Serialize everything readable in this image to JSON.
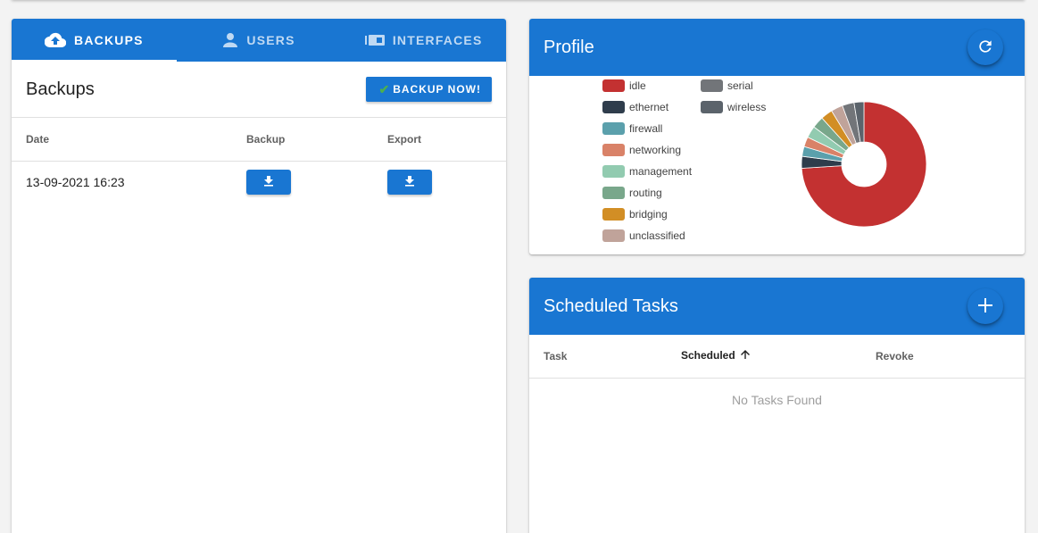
{
  "backups_card": {
    "tabs": [
      {
        "label": "BACKUPS",
        "icon": "cloud-upload-icon",
        "active": true
      },
      {
        "label": "USERS",
        "icon": "person-icon",
        "active": false
      },
      {
        "label": "INTERFACES",
        "icon": "network-interface-icon",
        "active": false
      }
    ],
    "title": "Backups",
    "backup_now_label": "BACKUP NOW!",
    "columns": [
      "Date",
      "Backup",
      "Export"
    ],
    "rows": [
      {
        "date": "13-09-2021 16:23",
        "backup_icon": "download-icon",
        "export_icon": "download-icon"
      }
    ]
  },
  "profile_card": {
    "title": "Profile",
    "refresh_icon": "refresh-icon",
    "chart_data": {
      "type": "pie",
      "donut": true,
      "legend_position": "left",
      "labels": [
        "idle",
        "ethernet",
        "firewall",
        "networking",
        "management",
        "routing",
        "bridging",
        "unclassified",
        "serial",
        "wireless"
      ],
      "colors": [
        "#c33131",
        "#2f3d4c",
        "#5ba0ac",
        "#d98268",
        "#92cbb0",
        "#79a78b",
        "#d28e25",
        "#c0a39a",
        "#727579",
        "#5b636b"
      ],
      "values": [
        72.5,
        3,
        2.5,
        2.5,
        3,
        3,
        3,
        3,
        3,
        2.5
      ]
    }
  },
  "tasks_card": {
    "title": "Scheduled Tasks",
    "add_icon": "plus-icon",
    "columns": [
      "Task",
      "Scheduled",
      "Revoke"
    ],
    "sort_icon": "arrow-up-icon",
    "empty_text": "No Tasks Found"
  }
}
